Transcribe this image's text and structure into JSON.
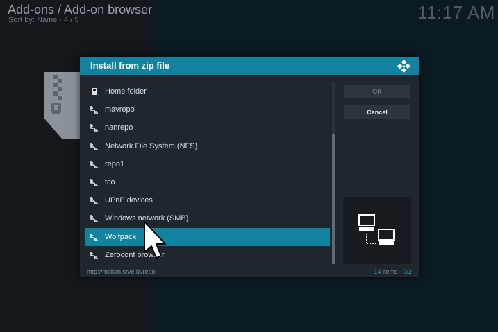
{
  "header": {
    "title": "Add-ons / Add-on browser",
    "subtitle": "Sort by: Name · 4 / 5",
    "clock": "11:17 AM"
  },
  "dialog": {
    "title": "Install from zip file",
    "items": [
      {
        "label": "Home folder",
        "icon": "home-folder-icon"
      },
      {
        "label": "mavrepo",
        "icon": "network-share-icon"
      },
      {
        "label": "nanrepo",
        "icon": "network-share-icon"
      },
      {
        "label": "Network File System (NFS)",
        "icon": "network-share-icon"
      },
      {
        "label": "repo1",
        "icon": "network-share-icon"
      },
      {
        "label": "tco",
        "icon": "network-share-icon"
      },
      {
        "label": "UPnP devices",
        "icon": "network-share-icon"
      },
      {
        "label": "Windows network (SMB)",
        "icon": "network-share-icon"
      },
      {
        "label": "Wolfpack",
        "icon": "network-share-icon",
        "selected": true
      },
      {
        "label": "Zeroconf browser",
        "icon": "network-share-icon"
      }
    ],
    "buttons": {
      "ok": "OK",
      "cancel": "Cancel"
    },
    "footer": {
      "path": "http://midian.srve.io/repo",
      "count": "14",
      "count_suffix": " items - ",
      "page": "2/2"
    }
  },
  "colors": {
    "accent": "#12829e",
    "dialog_bg": "#1f272d",
    "background": "#111417"
  }
}
